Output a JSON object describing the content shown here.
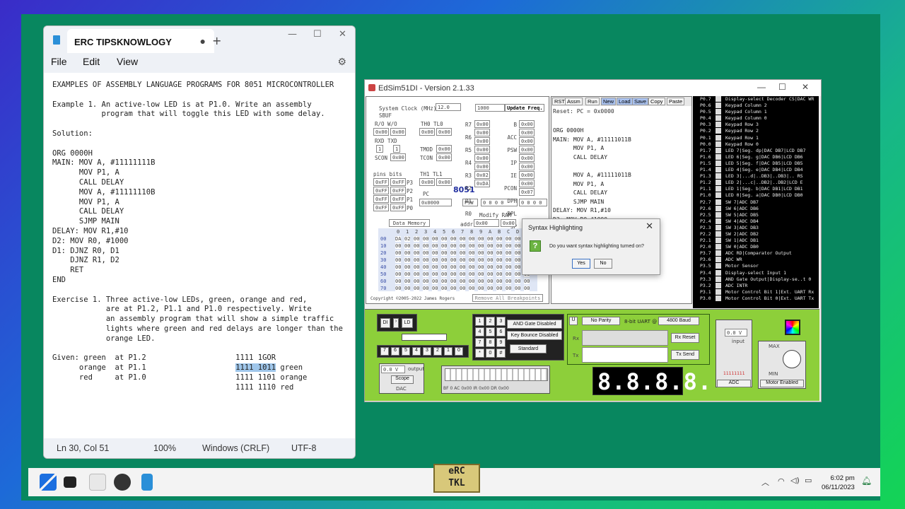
{
  "notepad": {
    "tab_title": "ERC TIPSKNOWLOGY",
    "menu": [
      "File",
      "Edit",
      "View"
    ],
    "content": [
      "EXAMPLES OF ASSEMBLY LANGUAGE PROGRAMS FOR 8051 MICROCONTROLLER",
      "",
      "Example 1. An active-low LED is at P1.0. Write an assembly",
      "           program that will toggle this LED with some delay.",
      "",
      "Solution:",
      "",
      "ORG 0000H",
      "MAIN: MOV A, #11111111B",
      "      MOV P1, A",
      "      CALL DELAY",
      "      MOV A, #11111110B",
      "      MOV P1, A",
      "      CALL DELAY",
      "      SJMP MAIN",
      "DELAY: MOV R1,#10",
      "D2: MOV R0, #1000",
      "D1: DJNZ R0, D1",
      "    DJNZ R1, D2",
      "    RET",
      "END",
      "",
      "Exercise 1. Three active-low LEDs, green, orange and red,",
      "            are at P1.2, P1.1 and P1.0 respectively. Write",
      "            an assembly program that will show a simple traffic",
      "            lights where green and red delays are longer than the",
      "            orange LED.",
      "",
      "Given: green  at P1.2                    1111 1GOR",
      "      orange  at P1.1                    ",
      "      red     at P1.0                    1111 1101 orange",
      "                                         1111 1110 red"
    ],
    "highlight_line_prefix": "      orange  at P1.1                    ",
    "highlight_text": "1111 1011",
    "highlight_suffix": " green",
    "status": {
      "position": "Ln 30, Col 51",
      "zoom": "100%",
      "line_ending": "Windows (CRLF)",
      "encoding": "UTF-8"
    }
  },
  "edsim": {
    "title": "EdSim51DI - Version 2.1.33",
    "system_clock_label": "System Clock (MHz)",
    "system_clock_value": "12.0",
    "update_freq_value": "1000",
    "update_freq_button": "Update Freq.",
    "chip_label": "8051",
    "data_memory_button": "Data Memory",
    "copyright": "Copyright ©2005-2022 James Rogers",
    "remove_breakpoints": "Remove All Breakpoints",
    "code_toolbar": [
      "RST",
      "Assm",
      "Run",
      "New",
      "Load",
      "Save",
      "Copy",
      "Paste"
    ],
    "reset_text": "Reset: PC = 0x0000",
    "code": "ORG 0000H\nMAIN: MOV A, #11111011B\n      MOV P1, A\n      CALL DELAY\n\n      MOV A, #11111011B\n      MOV P1, A\n      CALL DELAY\n      SJMP MAIN\nDELAY: MOV R1,#10\nD2: MOV R0,#1000",
    "pins": [
      [
        "P0.7",
        "Display-select Decoder CS|DAC WR"
      ],
      [
        "P0.6",
        "Keypad Column 2"
      ],
      [
        "P0.5",
        "Keypad Column 1"
      ],
      [
        "P0.4",
        "Keypad Column 0"
      ],
      [
        "P0.3",
        "Keypad Row 3"
      ],
      [
        "P0.2",
        "Keypad Row 2"
      ],
      [
        "P0.1",
        "Keypad Row 1"
      ],
      [
        "P0.0",
        "Keypad Row 0"
      ],
      [
        "P1.7",
        "LED 7|Seg. dp|DAC DB7|LCD DB7"
      ],
      [
        "P1.6",
        "LED 6|Seg. g|DAC DB6|LCD DB6"
      ],
      [
        "P1.5",
        "LED 5|Seg. f|DAC DB5|LCD DB5"
      ],
      [
        "P1.4",
        "LED 4|Seg. e|DAC DB4|LCD DB4"
      ],
      [
        "P1.3",
        "LED 3|...d|..DB3|..DB3|.. RS"
      ],
      [
        "P1.2",
        "LED 2|...c|..DB2|..DB2|LCD E"
      ],
      [
        "P1.1",
        "LED 1|Seg. b|DAC DB1|LCD DB1"
      ],
      [
        "P1.0",
        "LED 0|Seg. a|DAC DB0|LCD DB0"
      ],
      [
        "P2.7",
        "SW 7|ADC DB7"
      ],
      [
        "P2.6",
        "SW 6|ADC DB6"
      ],
      [
        "P2.5",
        "SW 5|ADC DB5"
      ],
      [
        "P2.4",
        "SW 4|ADC DB4"
      ],
      [
        "P2.3",
        "SW 3|ADC DB3"
      ],
      [
        "P2.2",
        "SW 2|ADC DB2"
      ],
      [
        "P2.1",
        "SW 1|ADC DB1"
      ],
      [
        "P2.0",
        "SW 0|ADC DB0"
      ],
      [
        "P3.7",
        "ADC RD|Comparator Output"
      ],
      [
        "P3.6",
        "ADC WR"
      ],
      [
        "P3.5",
        "Motor Sensor"
      ],
      [
        "P3.4",
        "Display-select Input 1"
      ],
      [
        "P3.3",
        "AND Gate Output|Display-se..t 0"
      ],
      [
        "P3.2",
        "ADC INTR"
      ],
      [
        "P3.1",
        "Motor Control Bit 1|Ext. UART Rx"
      ],
      [
        "P3.0",
        "Motor Control Bit 0|Ext. UART Tx"
      ]
    ],
    "and_gate": "AND Gate Disabled",
    "key_bounce": "Key Bounce Disabled",
    "standard": "Standard",
    "parity": "No Parity",
    "uart_label": "8-bit UART @",
    "baud": "4800 Baud",
    "rx_reset": "Rx Reset",
    "tx_send": "Tx Send",
    "rx": "Rx",
    "tx": "Tx",
    "dac_value": "0.0 V",
    "dac_output": "output",
    "scope": "Scope",
    "dac": "DAC",
    "adc_value": "0.0 V",
    "adc_input": "input",
    "adc_bits": "11111111",
    "adc": "ADC",
    "max": "MAX",
    "min": "MIN",
    "motor": "Motor Enabled",
    "seg_display": "8.8.8.8.",
    "dl_buttons": [
      "DI",
      "LD"
    ],
    "switch_labels": [
      "7",
      "6",
      "5",
      "4",
      "3",
      "2",
      "1",
      "0"
    ],
    "keypad": [
      "1",
      "2",
      "3",
      "4",
      "5",
      "6",
      "7",
      "8",
      "9",
      "*",
      "0",
      "#"
    ],
    "lcd_fields": [
      "BF",
      "AC",
      "0x00",
      "IR",
      "0x00",
      "DR",
      "0x00"
    ]
  },
  "dialog": {
    "title": "Syntax Highlighting",
    "message": "Do you want syntax highlighting turned on?",
    "yes": "Yes",
    "no": "No"
  },
  "taskbar": {
    "time": "6:02 pm",
    "date": "06/11/2023"
  },
  "logo_text": [
    "eRC",
    "TKL"
  ]
}
